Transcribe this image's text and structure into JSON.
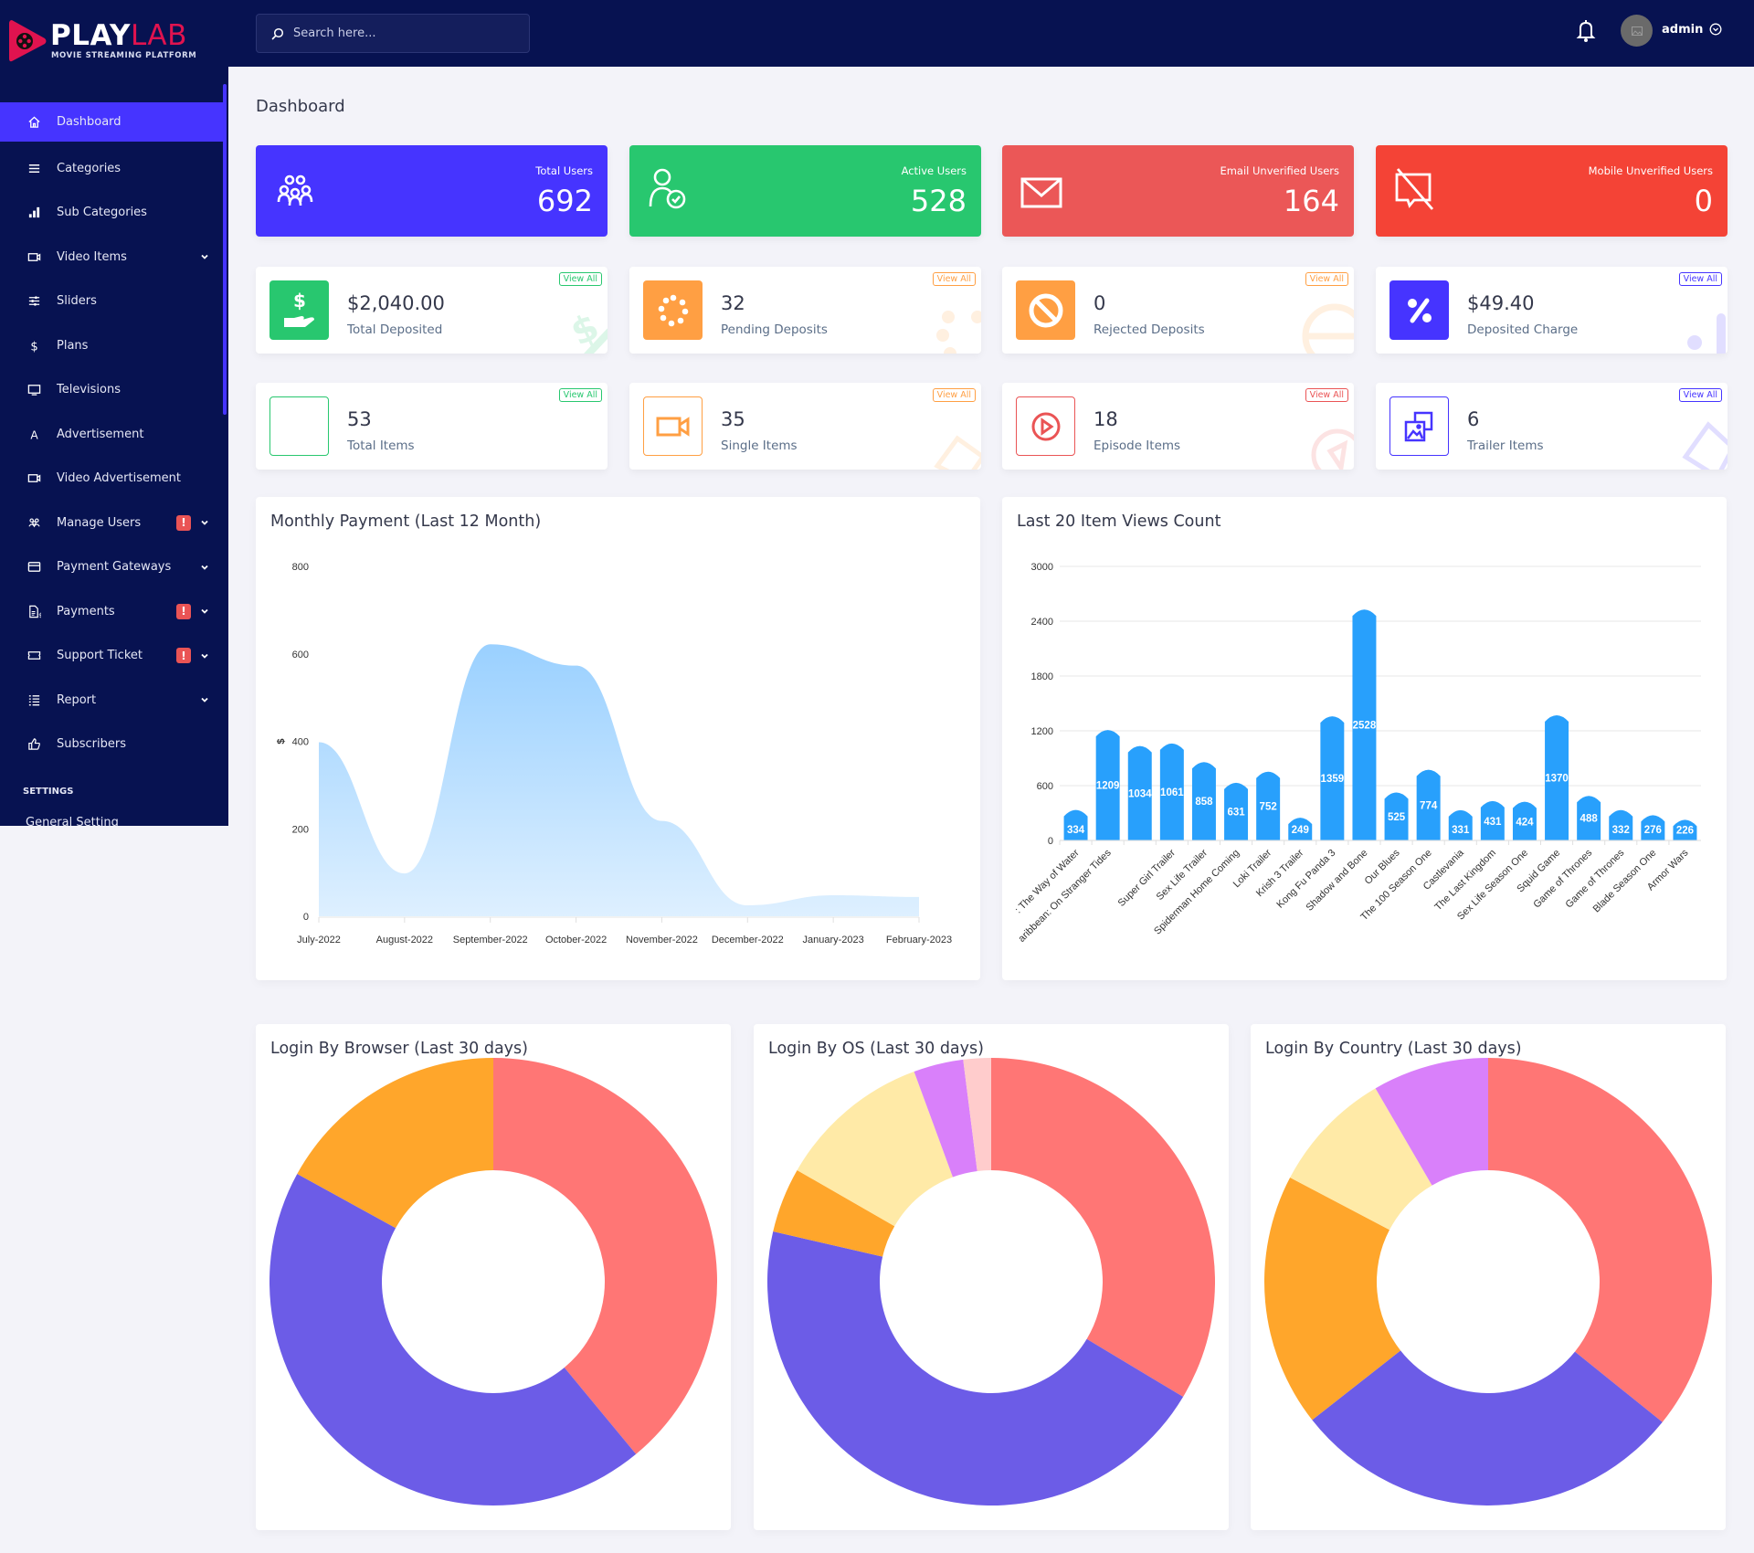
{
  "header": {
    "search_placeholder": "Search here...",
    "username": "admin"
  },
  "brand": {
    "name_main": "PLAY",
    "name_accent": "LAB",
    "tagline": "MOVIE STREAMING PLATFORM"
  },
  "sidebar": {
    "items": [
      {
        "label": "Dashboard",
        "icon": "home-icon",
        "active": true
      },
      {
        "label": "Categories",
        "icon": "menu-icon"
      },
      {
        "label": "Sub Categories",
        "icon": "bar-chart-icon"
      },
      {
        "label": "Video Items",
        "icon": "video-camera-icon",
        "dropdown": true
      },
      {
        "label": "Sliders",
        "icon": "sliders-icon"
      },
      {
        "label": "Plans",
        "icon": "dollar-icon"
      },
      {
        "label": "Televisions",
        "icon": "tv-icon"
      },
      {
        "label": "Advertisement",
        "icon": "font-a-icon"
      },
      {
        "label": "Video Advertisement",
        "icon": "video-camera-icon"
      },
      {
        "label": "Manage Users",
        "icon": "users-icon",
        "badge": "!",
        "dropdown": true
      },
      {
        "label": "Payment Gateways",
        "icon": "credit-card-icon",
        "dropdown": true
      },
      {
        "label": "Payments",
        "icon": "invoice-dollar-icon",
        "badge": "!",
        "dropdown": true
      },
      {
        "label": "Support Ticket",
        "icon": "ticket-icon",
        "badge": "!",
        "dropdown": true
      },
      {
        "label": "Report",
        "icon": "list-icon",
        "dropdown": true
      },
      {
        "label": "Subscribers",
        "icon": "thumbs-up-icon"
      }
    ],
    "section_label": "SETTINGS",
    "partial_item": "General Setting"
  },
  "page": {
    "title": "Dashboard"
  },
  "stats": [
    {
      "label": "Total Users",
      "value": "692",
      "color": "#4634ff"
    },
    {
      "label": "Active Users",
      "value": "528",
      "color": "#28c76f"
    },
    {
      "label": "Email Unverified Users",
      "value": "164",
      "color": "#eb5757"
    },
    {
      "label": "Mobile Unverified Users",
      "value": "0",
      "color": "#f44336"
    }
  ],
  "widgets": [
    {
      "value": "$2,040.00",
      "caption": "Total Deposited",
      "view_all": "View All",
      "color": "#28c76f"
    },
    {
      "value": "32",
      "caption": "Pending Deposits",
      "view_all": "View All",
      "color": "#ff9f43"
    },
    {
      "value": "0",
      "caption": "Rejected Deposits",
      "view_all": "View All",
      "color": "#ff9f43"
    },
    {
      "value": "$49.40",
      "caption": "Deposited Charge",
      "view_all": "View All",
      "color": "#4634ff"
    },
    {
      "value": "53",
      "caption": "Total Items",
      "view_all": "View All",
      "color": "#28c76f"
    },
    {
      "value": "35",
      "caption": "Single Items",
      "view_all": "View All",
      "color": "#ff9f43"
    },
    {
      "value": "18",
      "caption": "Episode Items",
      "view_all": "View All",
      "color": "#ea5455"
    },
    {
      "value": "6",
      "caption": "Trailer Items",
      "view_all": "View All",
      "color": "#4634ff"
    }
  ],
  "chart_data": [
    {
      "type": "area",
      "title": "Monthly Payment (Last 12 Month)",
      "xlabel": "",
      "ylabel": "$",
      "x": [
        "July-2022",
        "August-2022",
        "September-2022",
        "October-2022",
        "November-2022",
        "December-2022",
        "January-2023",
        "February-2023"
      ],
      "values": [
        398,
        98,
        622,
        573,
        218,
        25,
        48,
        44
      ],
      "yticks": [
        0,
        200,
        400,
        600,
        800
      ],
      "ylim": [
        0,
        800
      ],
      "grid": false,
      "color": "#88c8ff"
    },
    {
      "type": "bar",
      "title": "Last 20 Item Views Count",
      "categories": [
        "Avatar: The Way of Water",
        "Pirates of the Caribbean: On Stranger Tides",
        "",
        "Super Girl Trailer",
        "Sex Life Trailer",
        "Spiderman Home Coming",
        "Loki Trailer",
        "Krish 3 Trailer",
        "Kong Fu Panda 3",
        "Shadow and Bone",
        "Our Blues",
        "The 100 Season One",
        "Castlevania",
        "The Last Kingdom",
        "Sex Life Season One",
        "Squid Game",
        "Game of Thrones",
        "Game of Thrones",
        "Blade Season One",
        "Armor Wars"
      ],
      "display_categories": [
        ": The Way of Water",
        "aribbean: On Stranger Tides",
        "",
        "Super Girl Trailer",
        "Sex Life Trailer",
        "Spiderman Home Coming",
        "Loki Trailer",
        "Krish 3 Trailer",
        "Kong Fu Panda 3",
        "Shadow and Bone",
        "Our Blues",
        "The 100 Season One",
        "Castlevania",
        "The Last Kingdom",
        "Sex Life Season One",
        "Squid Game",
        "Game of Thrones",
        "Game of Thrones",
        "Blade Season One",
        "Armor Wars"
      ],
      "values": [
        334,
        1209,
        1034,
        1061,
        858,
        631,
        752,
        249,
        1359,
        2528,
        525,
        774,
        331,
        431,
        424,
        1370,
        488,
        332,
        276,
        226
      ],
      "yticks": [
        0,
        600,
        1200,
        1800,
        2400,
        3000
      ],
      "ylim": [
        0,
        3000
      ],
      "grid": true,
      "color": "#28a0fc"
    },
    {
      "type": "pie",
      "title": "Login By Browser (Last 30 days)",
      "donut": true,
      "values": [
        39,
        44,
        17
      ],
      "colors": [
        "#ff7675",
        "#6c5ce7",
        "#ffa62b"
      ]
    },
    {
      "type": "pie",
      "title": "Login By OS (Last 30 days)",
      "donut": true,
      "values": [
        33.6,
        45,
        4.7,
        11.1,
        3.6,
        2
      ],
      "colors": [
        "#ff7675",
        "#6c5ce7",
        "#ffa62b",
        "#ffeaa7",
        "#d980fa",
        "#ffcccc"
      ]
    },
    {
      "type": "pie",
      "title": "Login By Country (Last 30 days)",
      "donut": true,
      "values": [
        35.8,
        28.6,
        18.3,
        8.9,
        8.4
      ],
      "colors": [
        "#ff7675",
        "#6c5ce7",
        "#ffa62b",
        "#ffeaa7",
        "#d980fa"
      ]
    }
  ]
}
